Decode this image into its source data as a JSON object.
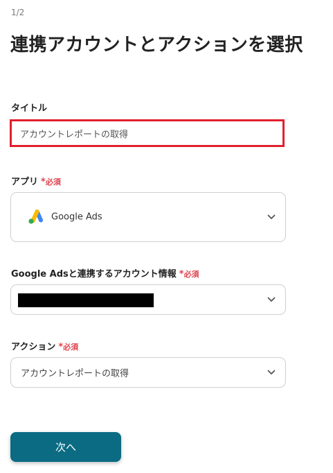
{
  "step_indicator": "1/2",
  "page_title": "連携アカウントとアクションを選択",
  "required_text": "必須",
  "required_mark": "*",
  "fields": {
    "title": {
      "label": "タイトル",
      "value": "アカウントレポートの取得"
    },
    "app": {
      "label": "アプリ",
      "value": "Google Ads",
      "icon": "google-ads-logo"
    },
    "account": {
      "label": "Google Adsと連携するアカウント情報"
    },
    "action": {
      "label": "アクション",
      "value": "アカウントレポートの取得"
    }
  },
  "buttons": {
    "next": "次へ"
  },
  "colors": {
    "primary": "#0b6b83",
    "required": "#e0424d",
    "highlight_border": "#e0202d"
  }
}
